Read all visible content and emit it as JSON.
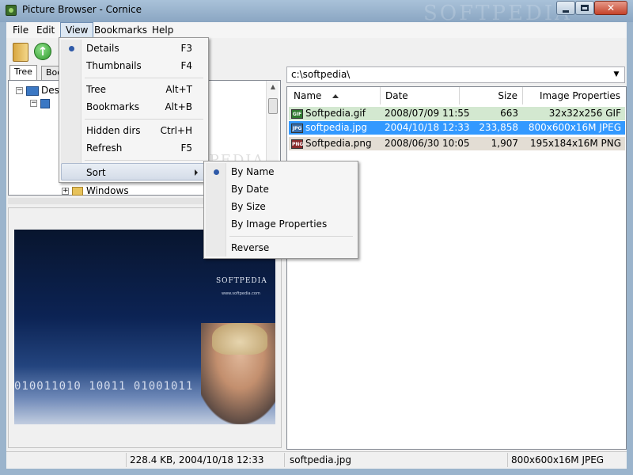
{
  "window": {
    "title": "Picture Browser - Cornice",
    "watermark": "SOFTPEDIA"
  },
  "menubar": [
    "File",
    "Edit",
    "View",
    "Bookmarks",
    "Help"
  ],
  "toolbar": {
    "buttons": [
      "folder-icon",
      "up-arrow-icon"
    ]
  },
  "left_pane": {
    "tabs": [
      "Tree",
      "Boo"
    ],
    "tree": [
      {
        "label": "Des",
        "icon": "desktop-icon"
      },
      {
        "label": "",
        "icon": "computer-icon"
      },
      {
        "label": "Windows",
        "icon": "folder-icon"
      }
    ]
  },
  "path": "c:\\softpedia\\",
  "file_list": {
    "columns": [
      "Name",
      "Date",
      "Size",
      "Image Properties"
    ],
    "sorted_by": "Name",
    "rows": [
      {
        "badge": "GIF",
        "name": "Softpedia.gif",
        "date": "2008/07/09 11:55",
        "size": "663",
        "props": "32x32x256 GIF",
        "state": "green"
      },
      {
        "badge": "JPG",
        "name": "softpedia.jpg",
        "date": "2004/10/18 12:33",
        "size": "233,858",
        "props": "800x600x16M JPEG",
        "state": "selected"
      },
      {
        "badge": "PNG",
        "name": "Softpedia.png",
        "date": "2008/06/30 10:05",
        "size": "1,907",
        "props": "195x184x16M PNG",
        "state": "tan"
      }
    ]
  },
  "view_menu": {
    "items": [
      {
        "label": "Details",
        "shortcut": "F3",
        "checked": true
      },
      {
        "label": "Thumbnails",
        "shortcut": "F4"
      },
      {
        "label": "Tree",
        "shortcut": "Alt+T"
      },
      {
        "label": "Bookmarks",
        "shortcut": "Alt+B"
      },
      {
        "label": "Hidden dirs",
        "shortcut": "Ctrl+H"
      },
      {
        "label": "Refresh",
        "shortcut": "F5"
      },
      {
        "label": "Sort",
        "shortcut": "",
        "submenu": true
      }
    ]
  },
  "sort_submenu": {
    "items": [
      {
        "label": "By Name",
        "checked": true
      },
      {
        "label": "By Date"
      },
      {
        "label": "By Size"
      },
      {
        "label": "By Image Properties"
      },
      {
        "label": "Reverse"
      }
    ]
  },
  "preview": {
    "logo_text": "SOFTPEDIA",
    "sub_text": "www.softpedia.com",
    "digits": "010011010 10011 01001011"
  },
  "status": {
    "file_info": "228.4 KB, 2004/10/18 12:33",
    "file_name": "softpedia.jpg",
    "image_props": "800x600x16M JPEG"
  },
  "colors": {
    "row_green": "#d3e8d0",
    "row_selected": "#3399ff",
    "row_tan": "#e3ddd4",
    "accent": "#2f5aa8"
  }
}
